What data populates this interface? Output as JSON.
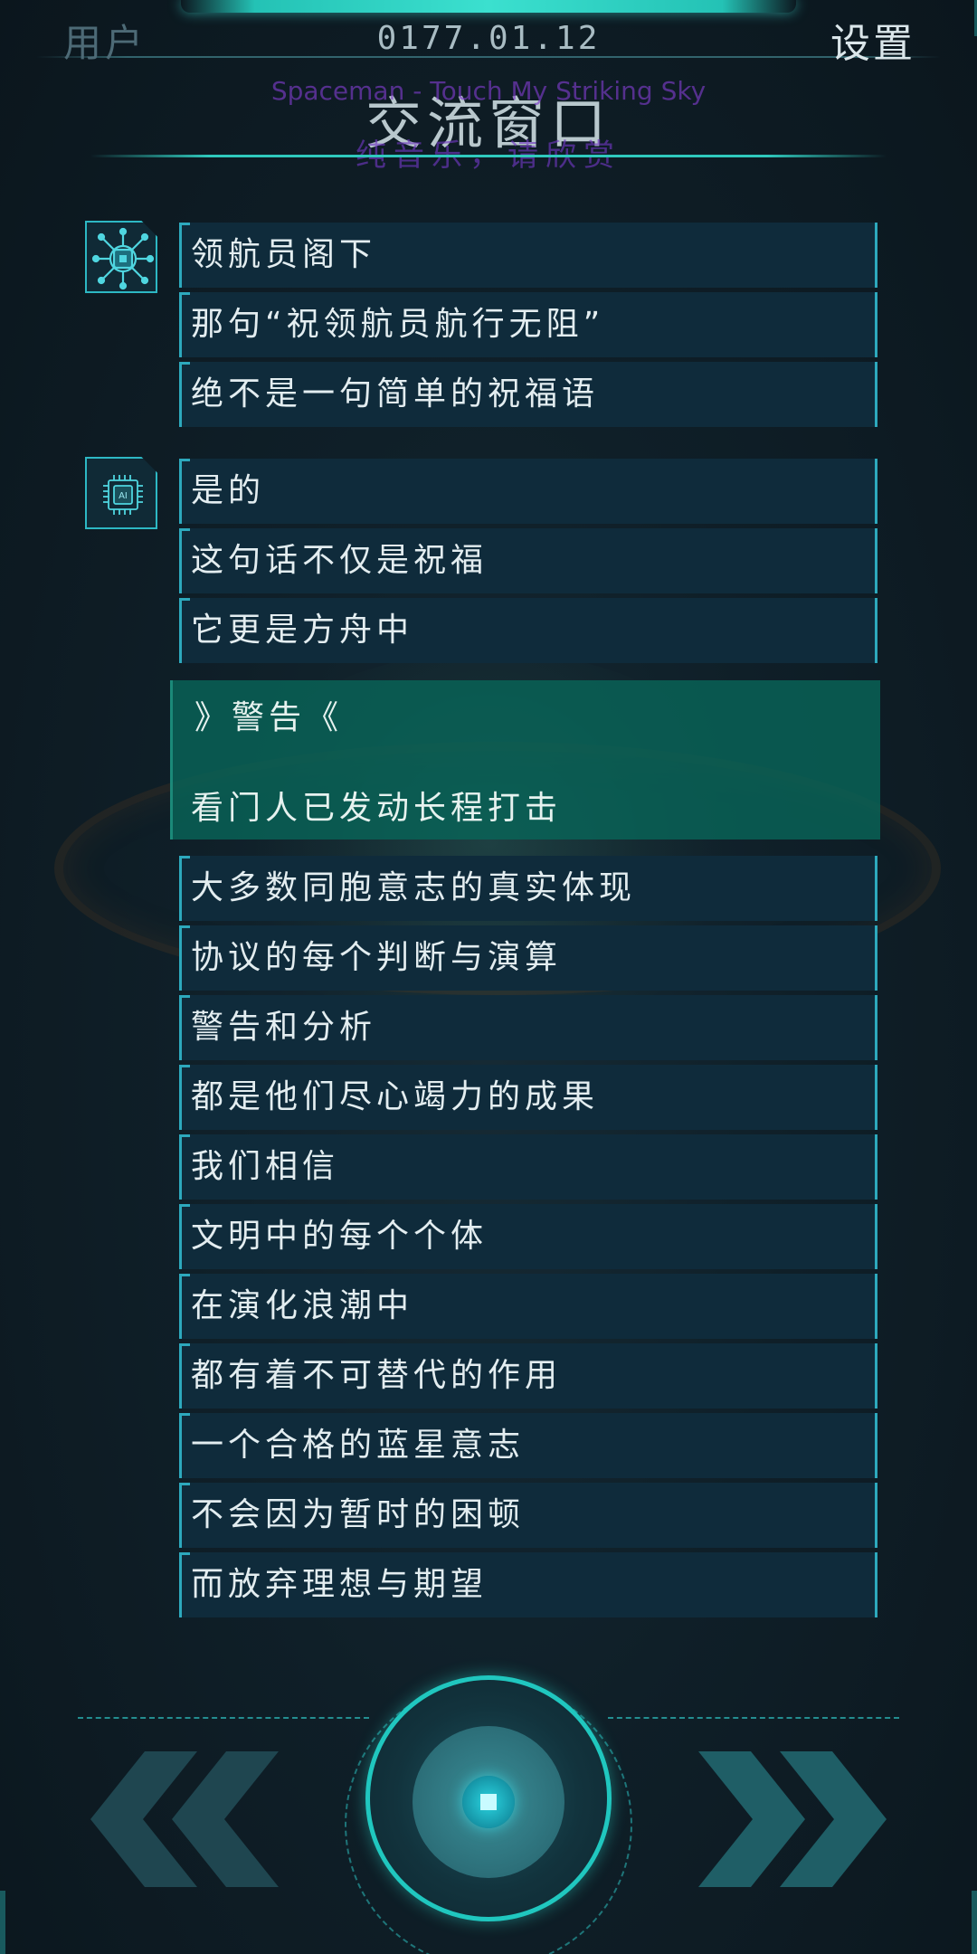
{
  "header": {
    "user_label": "用户",
    "date": "0177.01.12",
    "settings_label": "设置",
    "window_title": "交流窗口",
    "song_overlay": "Spaceman - Touch My Striking Sky",
    "song_subtitle": "纯音乐，请欣赏"
  },
  "chat": {
    "avatars": [
      {
        "icon": "circuit-brain-icon"
      },
      {
        "icon": "ai-chip-icon"
      }
    ],
    "group1": [
      "领航员阁下",
      "那句“祝领航员航行无阻”",
      "绝不是一句简单的祝福语"
    ],
    "group2": [
      "是的",
      "这句话不仅是祝福",
      "它更是方舟中"
    ],
    "warning": {
      "head": "》警告《",
      "body": "看门人已发动长程打击"
    },
    "group3": [
      "大多数同胞意志的真实体现",
      "协议的每个判断与演算",
      "警告和分析",
      "都是他们尽心竭力的成果",
      "我们相信",
      "文明中的每个个体",
      "在演化浪潮中",
      "都有着不可替代的作用",
      "一个合格的蓝星意志",
      "不会因为暂时的困顿",
      "而放弃理想与期望"
    ]
  },
  "controls": {
    "prev_icon": "double-chevron-left-icon",
    "play_icon": "stop-icon",
    "next_icon": "double-chevron-right-icon"
  },
  "colors": {
    "accent": "#2fc9bd",
    "bubble_bg": "#0f2b3b",
    "warning_bg": "#08645a",
    "background": "#0d1b24"
  }
}
